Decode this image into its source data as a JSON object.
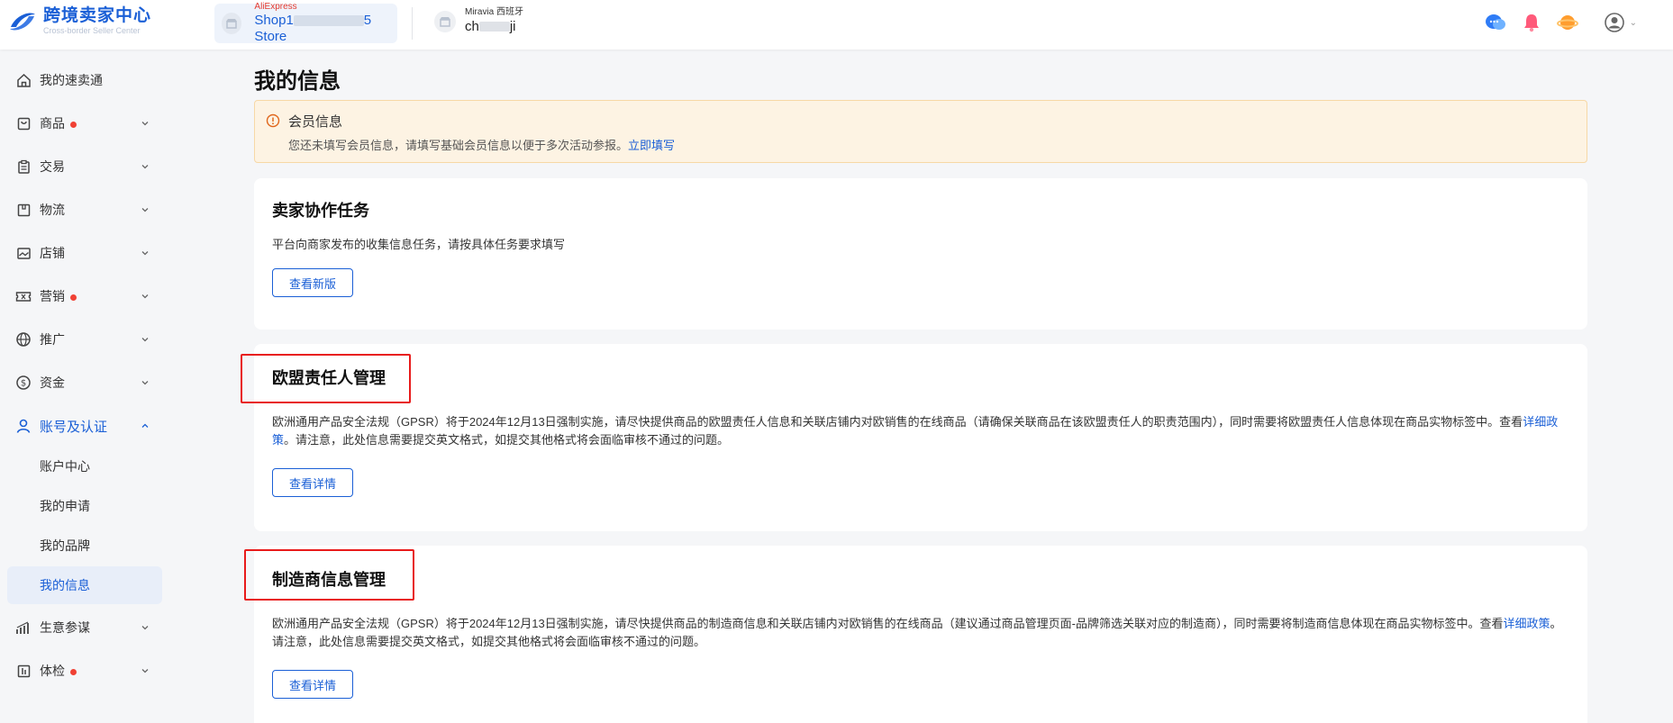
{
  "header": {
    "logo_title": "跨境卖家中心",
    "logo_sub": "Cross-border Seller Center",
    "store1": {
      "platform": "AliExpress",
      "name_prefix": "Shop1",
      "name_suffix": "5 Store"
    },
    "store2": {
      "platform": "Miravia 西班牙",
      "name_prefix": "ch",
      "name_suffix": "ji"
    },
    "icons": [
      "chat-icon",
      "bell-icon",
      "planet-icon",
      "user-avatar-icon"
    ]
  },
  "sidebar": {
    "items": [
      {
        "label": "我的速卖通",
        "icon": "home-icon",
        "dot": false,
        "chevron": false
      },
      {
        "label": "商品",
        "icon": "bag-icon",
        "dot": true,
        "chevron": "down"
      },
      {
        "label": "交易",
        "icon": "clipboard-icon",
        "dot": false,
        "chevron": "down"
      },
      {
        "label": "物流",
        "icon": "box-icon",
        "dot": false,
        "chevron": "down"
      },
      {
        "label": "店铺",
        "icon": "image-icon",
        "dot": false,
        "chevron": "down"
      },
      {
        "label": "营销",
        "icon": "ticket-icon",
        "dot": true,
        "chevron": "down"
      },
      {
        "label": "推广",
        "icon": "globe-icon",
        "dot": false,
        "chevron": "down"
      },
      {
        "label": "资金",
        "icon": "dollar-icon",
        "dot": false,
        "chevron": "down"
      },
      {
        "label": "账号及认证",
        "icon": "user-icon",
        "dot": false,
        "chevron": "up",
        "active": true
      },
      {
        "label": "生意参谋",
        "icon": "bar-chart-icon",
        "dot": false,
        "chevron": "down"
      },
      {
        "label": "体检",
        "icon": "health-icon",
        "dot": true,
        "chevron": "down"
      }
    ],
    "sub_items": [
      {
        "label": "账户中心"
      },
      {
        "label": "我的申请"
      },
      {
        "label": "我的品牌"
      },
      {
        "label": "我的信息",
        "selected": true
      }
    ]
  },
  "main": {
    "title": "我的信息",
    "alert": {
      "title": "会员信息",
      "text": "您还未填写会员信息，请填写基础会员信息以便于多次活动参报。",
      "link": "立即填写"
    },
    "cards": [
      {
        "title": "卖家协作任务",
        "desc_parts": [
          "平台向商家发布的收集信息任务，请按具体任务要求填写"
        ],
        "button": "查看新版"
      },
      {
        "title": "欧盟责任人管理",
        "desc_parts": [
          "欧洲通用产品安全法规（GPSR）将于2024年12月13日强制实施，请尽快提供商品的欧盟责任人信息和关联店铺内对欧销售的在线商品（请确保关联商品在该欧盟责任人的职责范围内），同时需要将欧盟责任人信息体现在商品实物标签中。查看",
          "详细政策",
          "。请注意，此处信息需要提交英文格式，如提交其他格式将会面临审核不通过的问题。"
        ],
        "button": "查看详情"
      },
      {
        "title": "制造商信息管理",
        "desc_parts": [
          "欧洲通用产品安全法规（GPSR）将于2024年12月13日强制实施，请尽快提供商品的制造商信息和关联店铺内对欧销售的在线商品（建议通过商品管理页面-品牌筛选关联对应的制造商），同时需要将制造商信息体现在商品实物标签中。查看",
          "详细政策",
          "。请注意，此处信息需要提交英文格式，如提交其他格式将会面临审核不通过的问题。"
        ],
        "button": "查看详情"
      }
    ]
  },
  "colors": {
    "accent": "#1a5fd6",
    "alert_bg": "#fdf3e3",
    "highlight": "#e81b1b",
    "dot": "#f04134"
  }
}
